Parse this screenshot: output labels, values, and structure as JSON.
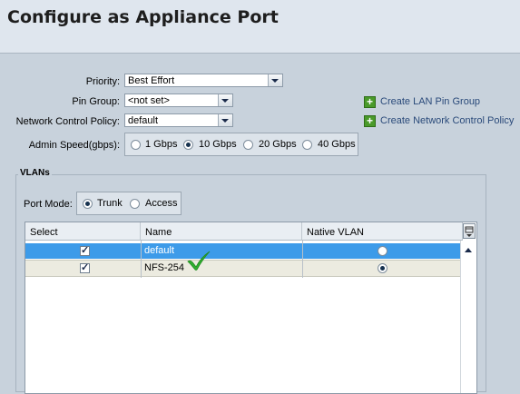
{
  "dialog": {
    "title": "Configure as Appliance Port"
  },
  "form": {
    "priority": {
      "label": "Priority:",
      "value": "Best Effort"
    },
    "pin_group": {
      "label": "Pin Group:",
      "value": "<not set>"
    },
    "network_control_policy": {
      "label": "Network Control Policy:",
      "value": "default"
    },
    "admin_speed": {
      "label": "Admin Speed(gbps):",
      "options": [
        "1 Gbps",
        "10 Gbps",
        "20 Gbps",
        "40 Gbps"
      ],
      "selected": "10 Gbps"
    }
  },
  "actions": {
    "create_lan_pin_group": "Create LAN Pin Group",
    "create_network_control_policy": "Create Network Control Policy"
  },
  "vlans": {
    "legend": "VLANs",
    "port_mode": {
      "label": "Port Mode:",
      "options": [
        "Trunk",
        "Access"
      ],
      "selected": "Trunk"
    },
    "columns": [
      "Select",
      "Name",
      "Native VLAN"
    ],
    "rows": [
      {
        "select": true,
        "name": "default",
        "native": false,
        "highlighted": true
      },
      {
        "select": true,
        "name": "NFS-254",
        "native": true,
        "highlighted": false
      }
    ]
  },
  "colors": {
    "background": "#c8d2dc",
    "header_bg": "#dfe6ee",
    "selected_row": "#3d9be9",
    "alt_row": "#ecebe0",
    "link": "#2a4a7a",
    "plus_green": "#4a9a2a",
    "checkmark_green": "#2fb02f"
  },
  "icons": {
    "create": "plus-icon",
    "dropdown": "chevron-down-icon",
    "validation": "green-checkmark-icon",
    "column_chooser": "column-chooser-icon"
  }
}
